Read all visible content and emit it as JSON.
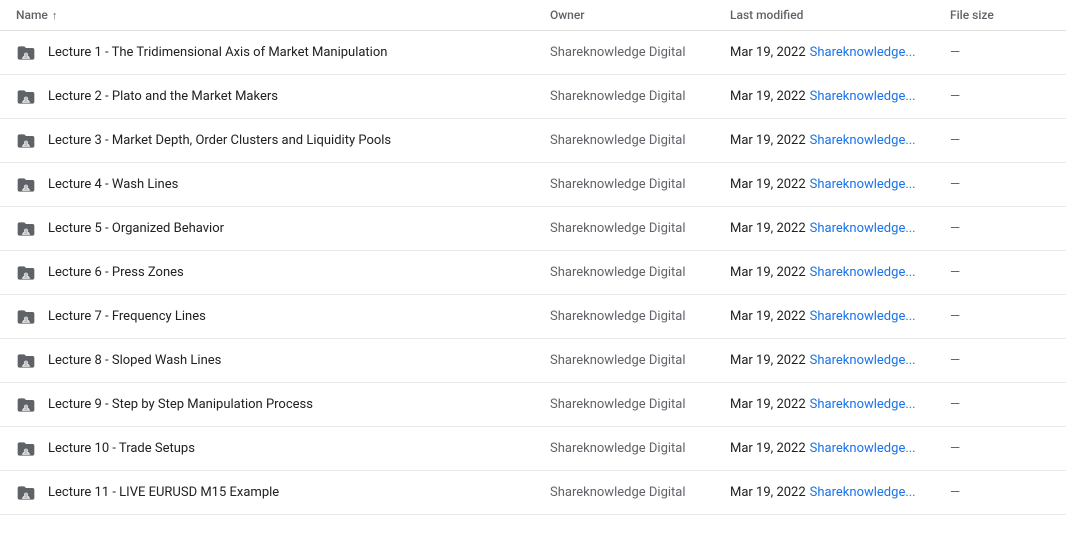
{
  "header": {
    "name_label": "Name",
    "sort_icon": "↑",
    "owner_label": "Owner",
    "modified_label": "Last modified",
    "size_label": "File size"
  },
  "rows": [
    {
      "id": 1,
      "name": "Lecture 1 - The Tridimensional Axis of Market Manipulation",
      "owner": "Shareknowledge Digital",
      "modified_date": "Mar 19, 2022",
      "modified_user": "Shareknowledge...",
      "size": "—"
    },
    {
      "id": 2,
      "name": "Lecture 2 - Plato and the Market Makers",
      "owner": "Shareknowledge Digital",
      "modified_date": "Mar 19, 2022",
      "modified_user": "Shareknowledge...",
      "size": "—"
    },
    {
      "id": 3,
      "name": "Lecture 3 - Market Depth, Order Clusters and Liquidity Pools",
      "owner": "Shareknowledge Digital",
      "modified_date": "Mar 19, 2022",
      "modified_user": "Shareknowledge...",
      "size": "—"
    },
    {
      "id": 4,
      "name": "Lecture 4 - Wash Lines",
      "owner": "Shareknowledge Digital",
      "modified_date": "Mar 19, 2022",
      "modified_user": "Shareknowledge...",
      "size": "—"
    },
    {
      "id": 5,
      "name": "Lecture 5 - Organized Behavior",
      "owner": "Shareknowledge Digital",
      "modified_date": "Mar 19, 2022",
      "modified_user": "Shareknowledge...",
      "size": "—"
    },
    {
      "id": 6,
      "name": "Lecture 6 - Press Zones",
      "owner": "Shareknowledge Digital",
      "modified_date": "Mar 19, 2022",
      "modified_user": "Shareknowledge...",
      "size": "—"
    },
    {
      "id": 7,
      "name": "Lecture 7 - Frequency Lines",
      "owner": "Shareknowledge Digital",
      "modified_date": "Mar 19, 2022",
      "modified_user": "Shareknowledge...",
      "size": "—"
    },
    {
      "id": 8,
      "name": "Lecture 8 - Sloped Wash Lines",
      "owner": "Shareknowledge Digital",
      "modified_date": "Mar 19, 2022",
      "modified_user": "Shareknowledge...",
      "size": "—"
    },
    {
      "id": 9,
      "name": "Lecture 9 - Step by Step Manipulation Process",
      "owner": "Shareknowledge Digital",
      "modified_date": "Mar 19, 2022",
      "modified_user": "Shareknowledge...",
      "size": "—"
    },
    {
      "id": 10,
      "name": "Lecture 10 - Trade Setups",
      "owner": "Shareknowledge Digital",
      "modified_date": "Mar 19, 2022",
      "modified_user": "Shareknowledge...",
      "size": "—"
    },
    {
      "id": 11,
      "name": "Lecture 11 - LIVE EURUSD M15 Example",
      "owner": "Shareknowledge Digital",
      "modified_date": "Mar 19, 2022",
      "modified_user": "Shareknowledge...",
      "size": "—"
    }
  ]
}
